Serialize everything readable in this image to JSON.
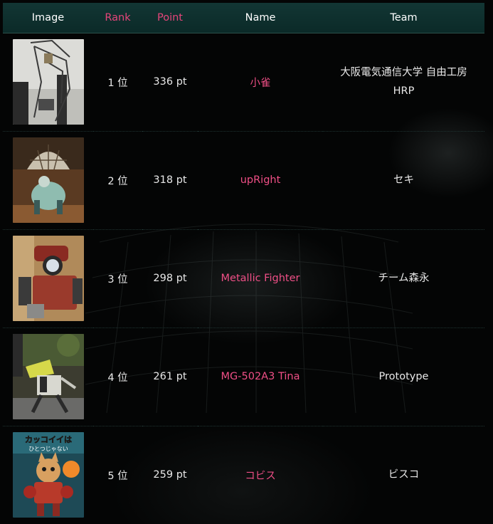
{
  "headers": {
    "image": "Image",
    "rank": "Rank",
    "point": "Point",
    "name": "Name",
    "team": "Team"
  },
  "colors": {
    "header_bg": "#0b2a28",
    "accent_pink": "#e6457a",
    "text": "#e8e8e8"
  },
  "rows": [
    {
      "rank": "1 位",
      "point": "336 pt",
      "name": "小雀",
      "team_line1": "大阪電気通信大学 自由工房",
      "team_line2": "HRP"
    },
    {
      "rank": "2 位",
      "point": "318 pt",
      "name": "upRight",
      "team_line1": "セキ",
      "team_line2": ""
    },
    {
      "rank": "3 位",
      "point": "298 pt",
      "name": "Metallic Fighter",
      "team_line1": "チーム森永",
      "team_line2": ""
    },
    {
      "rank": "4 位",
      "point": "261 pt",
      "name": "MG-502A3 Tina",
      "team_line1": "Prototype",
      "team_line2": ""
    },
    {
      "rank": "5 位",
      "point": "259 pt",
      "name": "コビス",
      "team_line1": "ビスコ",
      "team_line2": ""
    }
  ],
  "thumb_texts": {
    "row5_line1": "カッコイイは",
    "row5_line2": "ひとつじゃない"
  }
}
